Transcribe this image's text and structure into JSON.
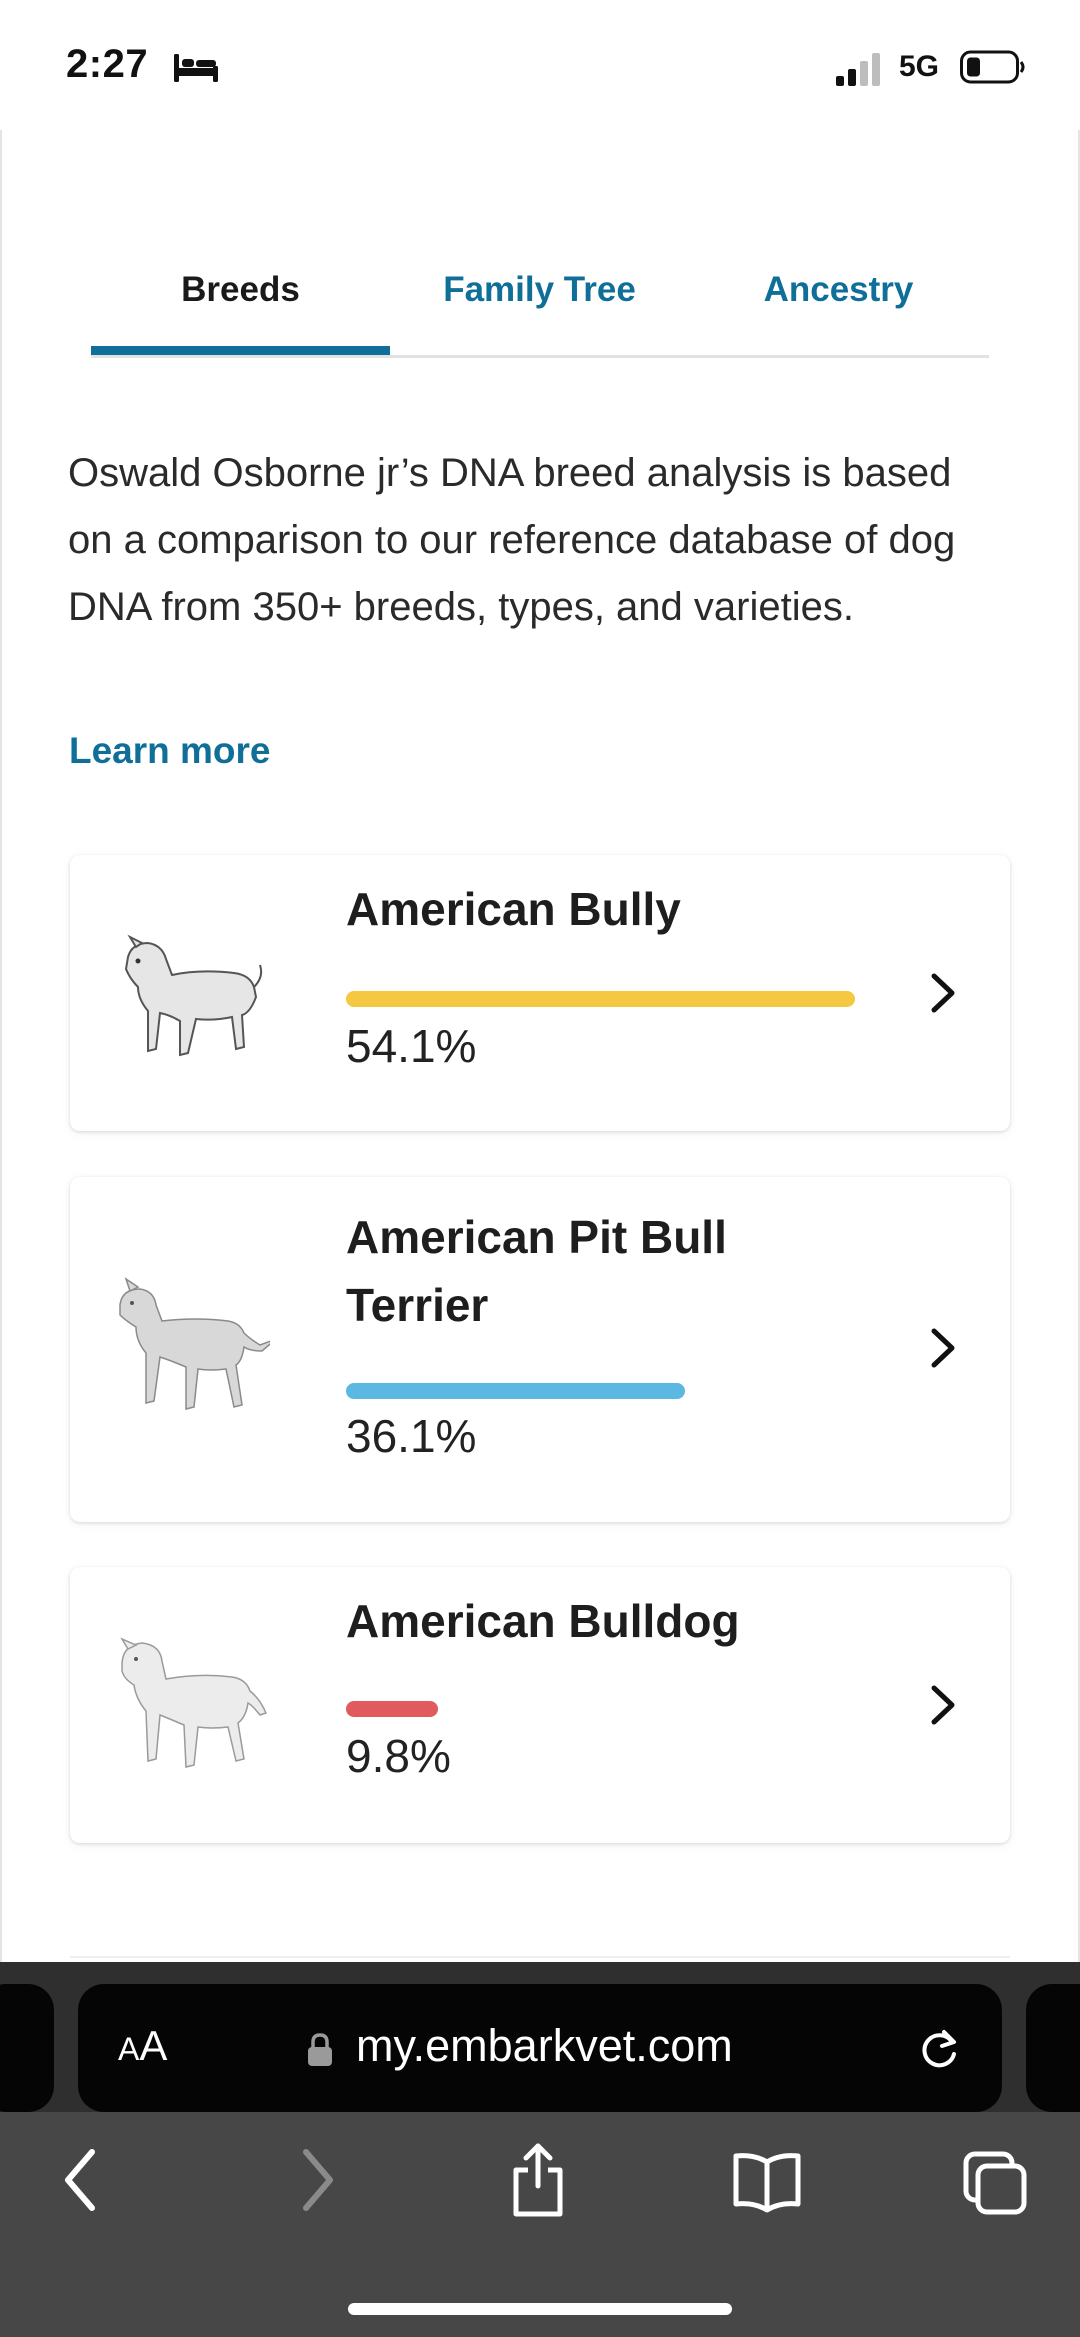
{
  "status_bar": {
    "time": "2:27",
    "network": "5G"
  },
  "tabs": [
    {
      "label": "Breeds",
      "active": true
    },
    {
      "label": "Family Tree",
      "active": false
    },
    {
      "label": "Ancestry",
      "active": false
    }
  ],
  "intro": {
    "text": "Oswald Osborne jr’s DNA breed analysis is based on a comparison to our reference database of dog DNA from 350+ breeds, types, and varieties.",
    "learn_more": "Learn more"
  },
  "breeds": [
    {
      "name": "American Bully",
      "percent_label": "54.1%",
      "percent": 54.1,
      "color": "#f5c842"
    },
    {
      "name": "American Pit Bull Terrier",
      "percent_label": "36.1%",
      "percent": 36.1,
      "color": "#5ab8e2"
    },
    {
      "name": "American Bulldog",
      "percent_label": "9.8%",
      "percent": 9.8,
      "color": "#e05a5e"
    }
  ],
  "colors": {
    "accent": "#0f6f98"
  },
  "browser": {
    "text_size_label": "AA",
    "url": "my.embarkvet.com",
    "icons": [
      "lock-icon",
      "reload-icon",
      "back-icon",
      "forward-icon",
      "share-icon",
      "bookmarks-icon",
      "tabs-icon"
    ]
  }
}
